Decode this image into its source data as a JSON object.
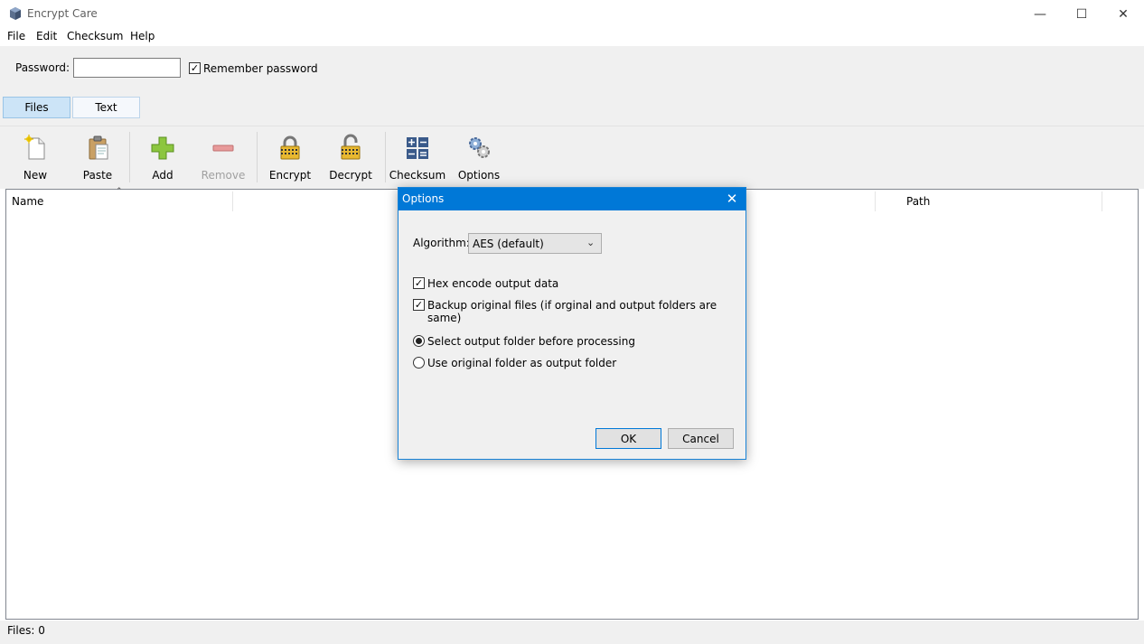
{
  "window": {
    "title": "Encrypt Care"
  },
  "menu": [
    "File",
    "Edit",
    "Checksum",
    "Help"
  ],
  "password": {
    "label": "Password:",
    "value": "",
    "remember_label": "Remember password",
    "remember_checked": true
  },
  "tabs": [
    "Files",
    "Text"
  ],
  "toolbar": {
    "new": "New",
    "paste": "Paste",
    "add": "Add",
    "remove": "Remove",
    "encrypt": "Encrypt",
    "decrypt": "Decrypt",
    "checksum": "Checksum",
    "options": "Options"
  },
  "filelist": {
    "columns": [
      "Name",
      "Path"
    ]
  },
  "status": {
    "text": "Files: 0"
  },
  "dialog": {
    "title": "Options",
    "algorithm_label": "Algorithm:",
    "algorithm_value": "AES (default)",
    "hex_label": "Hex encode output data",
    "backup_label": "Backup original files (if orginal and output folders are same)",
    "radio_select": "Select output folder before processing",
    "radio_original": "Use original folder as output folder",
    "ok": "OK",
    "cancel": "Cancel"
  },
  "colors": {
    "accent": "#0078d7",
    "tab_selected": "#cce4f7"
  },
  "icons": [
    "app-icon",
    "new-file-icon",
    "paste-icon",
    "add-icon",
    "remove-icon",
    "encrypt-lock-icon",
    "decrypt-lock-icon",
    "checksum-icon",
    "options-gear-icon"
  ]
}
